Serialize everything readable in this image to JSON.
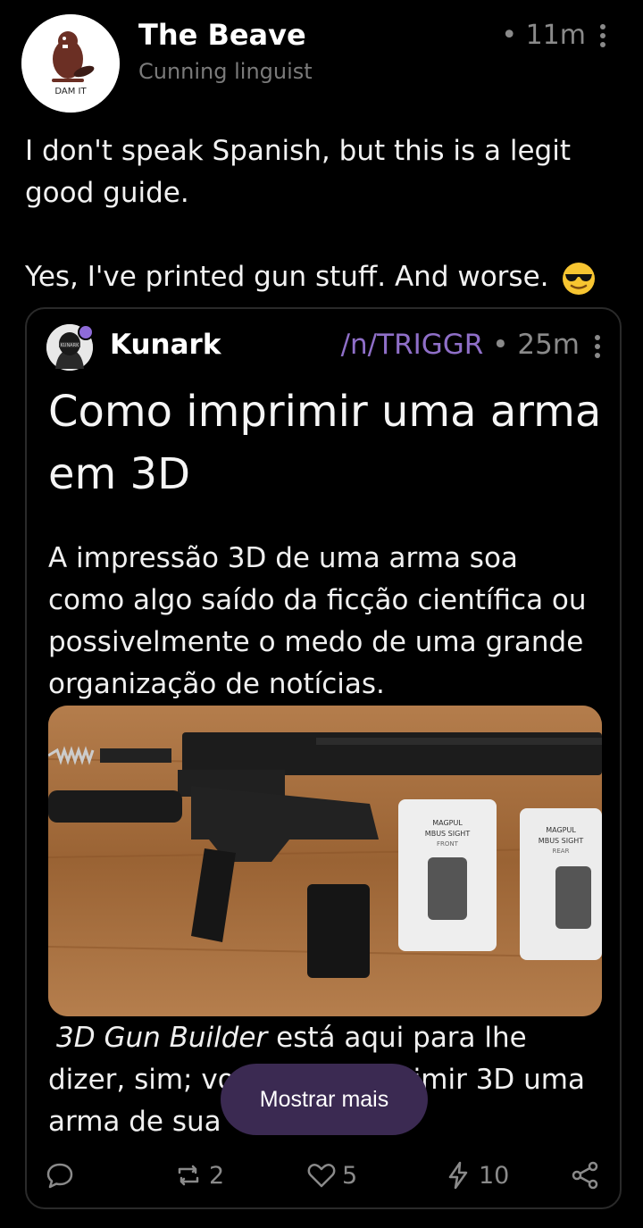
{
  "post": {
    "display_name": "The Beave",
    "username": "Cunning linguist",
    "avatar_caption": "DAM IT",
    "time": "• 11m",
    "paragraphs": [
      "I don't speak Spanish, but this is a legit good guide.",
      "Yes, I've printed gun stuff. And worse."
    ],
    "emoji": "sunglasses-emoji"
  },
  "quote": {
    "author": "Kunark",
    "avatar_caption": "KUNARK",
    "community": "/n/TRIGGR",
    "time": "• 25m",
    "title": "Como imprimir uma arma em 3D",
    "body": "A impressão 3D de uma arma soa como algo saído da ficção científica ou possivelmente o medo de uma grande organização de notícias.",
    "image_labels": {
      "brand": "MAGPUL",
      "front_title": "MBUS SIGHT",
      "front_sub": "FRONT",
      "rear_title": "MBUS SIGHT",
      "rear_sub": "REAR"
    },
    "body2_em": "3D Gun Builder",
    "body2_rest": " está aqui para lhe dizer, sim; vo",
    "body2_tail": "imir 3D uma",
    "body2_line3": "arma de sua",
    "show_more": "Mostrar mais"
  },
  "actions": {
    "comment_icon": "comment-icon",
    "repost_icon": "repost-icon",
    "repost_count": "2",
    "like_icon": "heart-icon",
    "like_count": "5",
    "zap_icon": "lightning-icon",
    "zap_count": "10",
    "share_icon": "share-icon"
  },
  "colors": {
    "background": "#000000",
    "muted": "#8a8a8a",
    "accent": "#8f6fc8",
    "show_more_bg": "#3b2a52"
  }
}
